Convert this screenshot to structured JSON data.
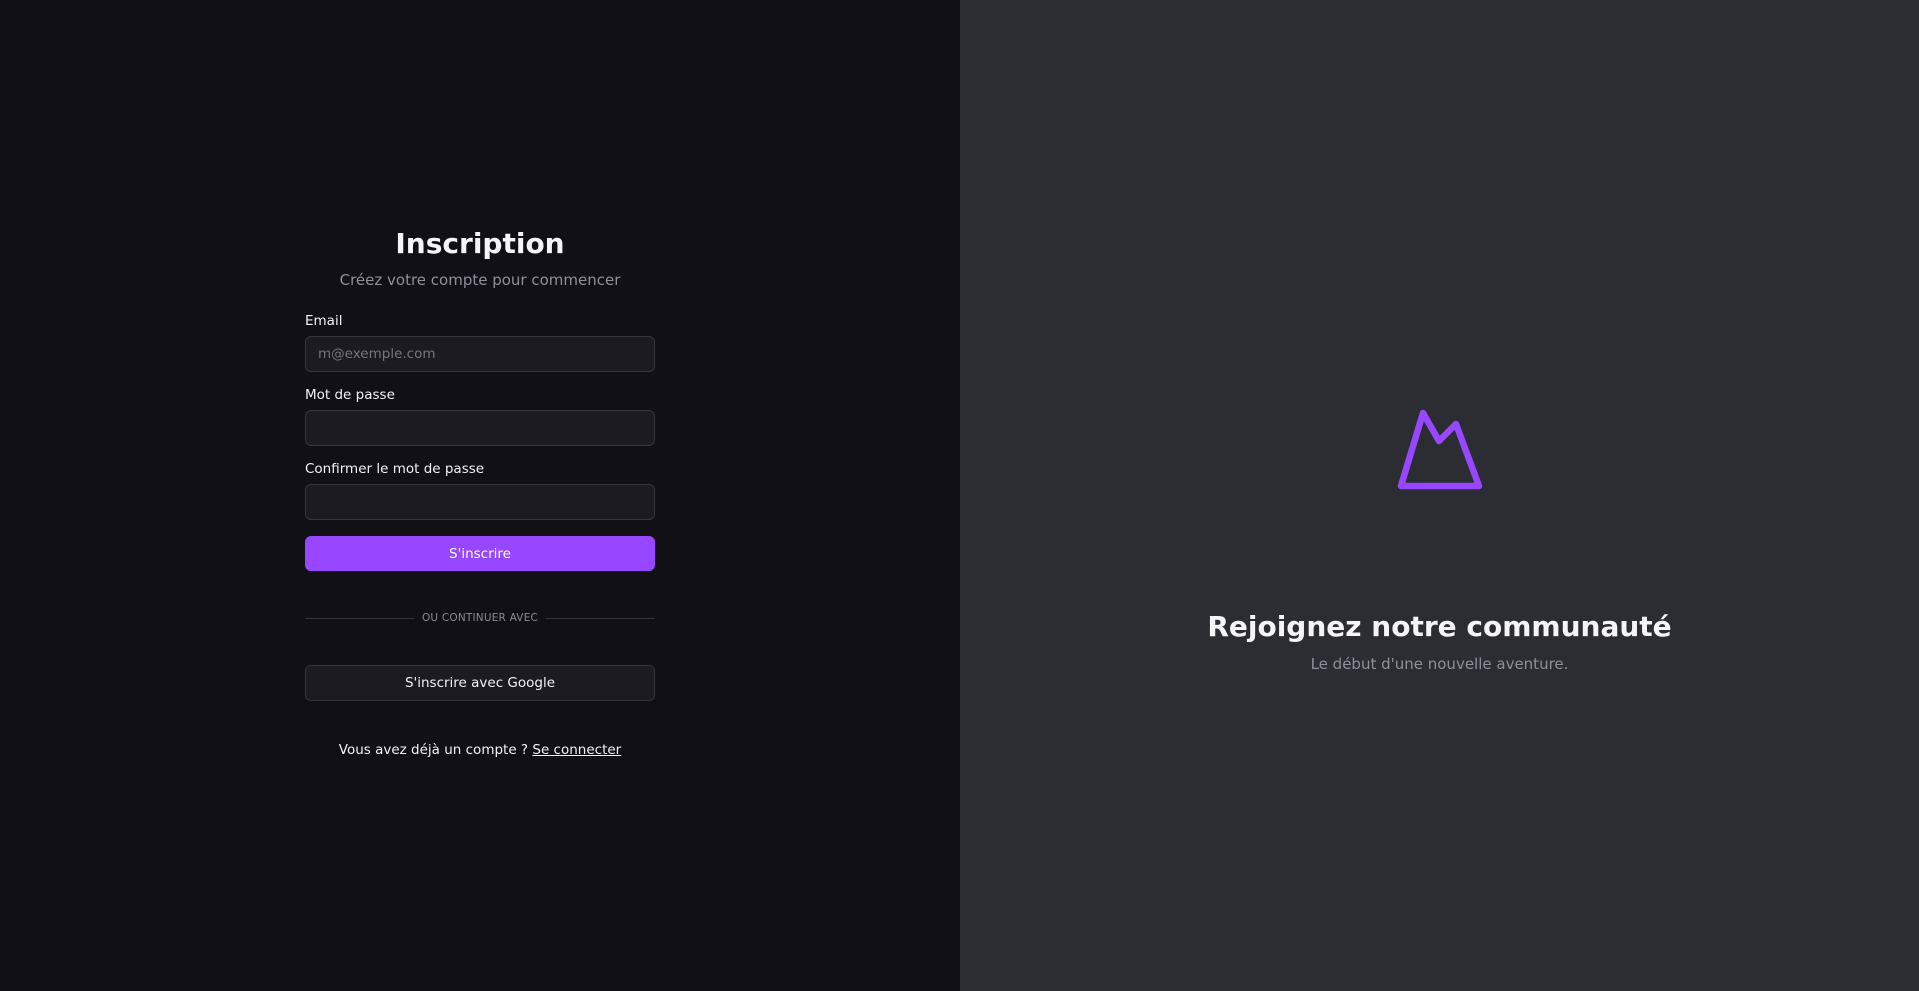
{
  "signup": {
    "title": "Inscription",
    "subtitle": "Créez votre compte pour commencer",
    "email": {
      "label": "Email",
      "placeholder": "m@exemple.com",
      "value": ""
    },
    "password": {
      "label": "Mot de passe",
      "value": ""
    },
    "confirm_password": {
      "label": "Confirmer le mot de passe",
      "value": ""
    },
    "submit_label": "S'inscrire",
    "divider_text": "OU CONTINUER AVEC",
    "google_label": "S'inscrire avec Google",
    "footer_text": "Vous avez déjà un compte ?",
    "login_link": "Se connecter"
  },
  "hero": {
    "logo_icon": "mountain-logo-icon",
    "title": "Rejoignez notre communauté",
    "subtitle": "Le début d'une nouvelle aventure."
  },
  "colors": {
    "accent": "#9747ff",
    "left_bg": "#111016",
    "right_bg": "#2c2c33"
  }
}
